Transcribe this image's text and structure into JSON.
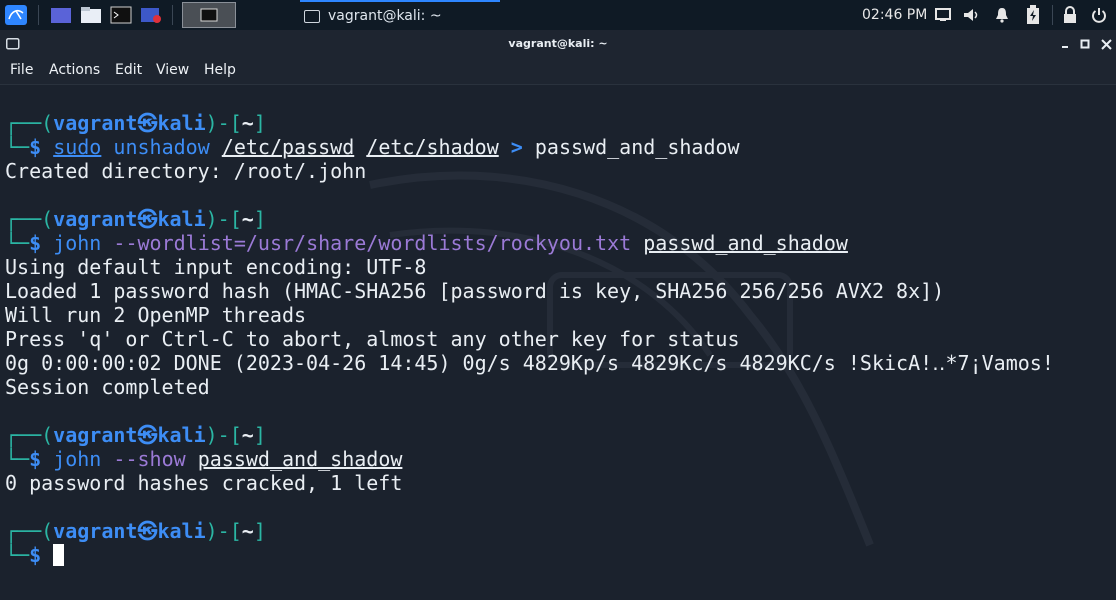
{
  "taskbar": {
    "active_task_title": "vagrant@kali: ~",
    "clock": "02:46 PM",
    "launchers": [
      "kali-menu-icon",
      "workspace-icon",
      "file-manager-icon",
      "terminal-icon",
      "screen-recorder-icon"
    ]
  },
  "window": {
    "title": "vagrant@kali: ~"
  },
  "menu": [
    "File",
    "Actions",
    "Edit",
    "View",
    "Help"
  ],
  "prompt": {
    "user": "vagrant",
    "host": "kali",
    "dir": "~",
    "symbol": "$"
  },
  "commands": {
    "c1": {
      "sudo": "sudo",
      "bin": "unshadow",
      "arg1": "/etc/passwd",
      "arg2": "/etc/shadow",
      "redir": ">",
      "out": "passwd_and_shadow"
    },
    "c2": {
      "bin": "john",
      "opt": "--wordlist=/usr/share/wordlists/rockyou.txt",
      "file": "passwd_and_shadow"
    },
    "c3": {
      "bin": "john",
      "opt": "--show",
      "file": "passwd_and_shadow"
    }
  },
  "output": {
    "o1": "Created directory: /root/.john",
    "o2": [
      "Using default input encoding: UTF-8",
      "Loaded 1 password hash (HMAC-SHA256 [password is key, SHA256 256/256 AVX2 8x])",
      "Will run 2 OpenMP threads",
      "Press 'q' or Ctrl-C to abort, almost any other key for status",
      "0g 0:00:00:02 DONE (2023-04-26 14:45) 0g/s 4829Kp/s 4829Kc/s 4829KC/s !SkicA!‥*7¡Vamos!",
      "Session completed"
    ],
    "o3": "0 password hashes cracked, 1 left"
  }
}
